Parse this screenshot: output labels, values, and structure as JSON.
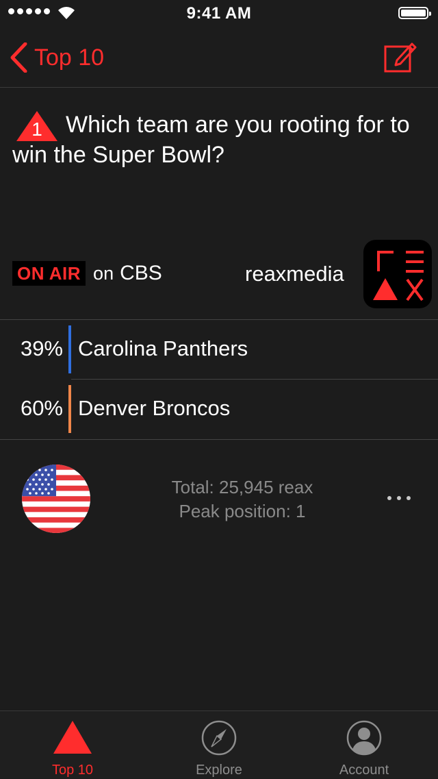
{
  "status_bar": {
    "time": "9:41 AM"
  },
  "nav": {
    "back_label": "Top 10"
  },
  "question": {
    "rank": "1",
    "text": "Which team are you rooting for to win the Super Bowl?"
  },
  "broadcast": {
    "on_air_label": "ON AIR",
    "on_text": "on",
    "network": "CBS",
    "brand_name": "reaxmedia"
  },
  "options": [
    {
      "percent": "39%",
      "label": "Carolina Panthers",
      "color": "#2f6fe0"
    },
    {
      "percent": "60%",
      "label": "Denver Broncos",
      "color": "#f0864a"
    }
  ],
  "stats": {
    "total": "Total: 25,945 reax",
    "peak": "Peak position: 1"
  },
  "tabs": [
    {
      "label": "Top 10",
      "icon": "triangle-icon",
      "active": true
    },
    {
      "label": "Explore",
      "icon": "compass-icon",
      "active": false
    },
    {
      "label": "Account",
      "icon": "person-icon",
      "active": false
    }
  ],
  "colors": {
    "accent": "#ff2d2d",
    "background": "#1c1c1c"
  }
}
